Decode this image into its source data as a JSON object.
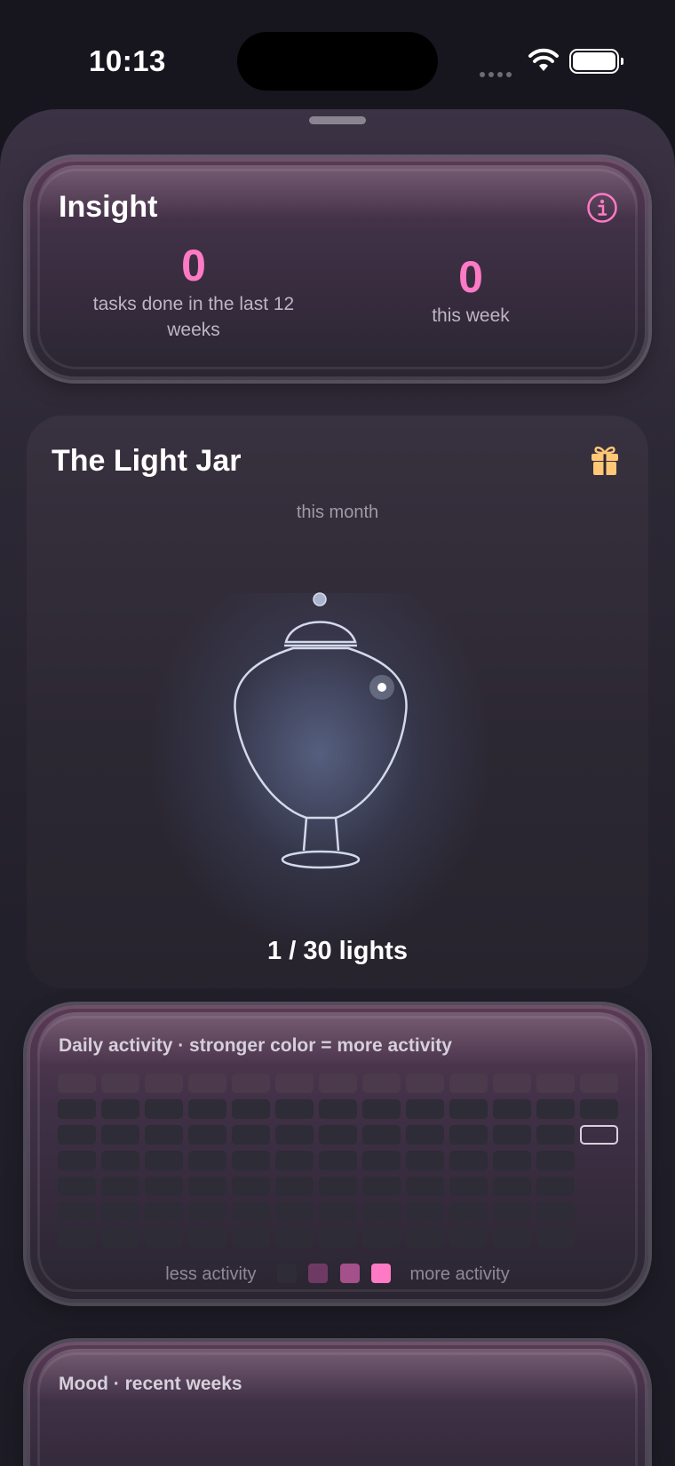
{
  "status": {
    "time": "10:13"
  },
  "insight": {
    "title": "Insight",
    "total_value": "0",
    "total_label": "tasks done in the last 12 weeks",
    "week_value": "0",
    "week_label": "this week",
    "accent": "#ff7ac4"
  },
  "light_jar": {
    "title": "The Light Jar",
    "subtitle": "this month",
    "count_label": "1 / 30 lights"
  },
  "activity": {
    "title": "Daily activity · stronger color = more activity",
    "legend_less": "less activity",
    "legend_more": "more activity",
    "legend_colors": [
      "#2e2c36",
      "#6e3a63",
      "#a4508a",
      "#ff7ac4"
    ],
    "weeks": 13,
    "days_per_week": 7,
    "values_all_zero": true
  },
  "mood": {
    "title": "Mood · recent weeks"
  }
}
